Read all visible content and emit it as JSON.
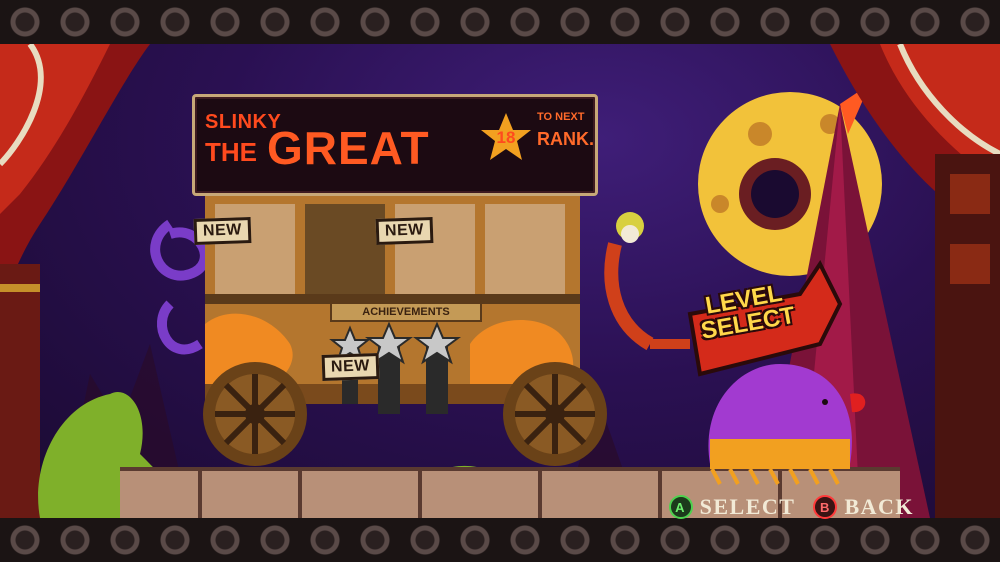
{
  "header": {
    "name_line1": "SLINKY",
    "name_line2": "THE",
    "rank_title": "GREAT",
    "stars_to_next": "18",
    "next_line1": "TO NEXT",
    "next_line2": "RANK."
  },
  "wagon": {
    "new_badges": [
      "NEW",
      "NEW",
      "NEW"
    ],
    "achievements_label": "ACHIEVEMENTS"
  },
  "level_select": {
    "line1": "LEVEL",
    "line2": "SELECT"
  },
  "controls": {
    "select_button": "A",
    "select_label": "SELECT",
    "back_button": "B",
    "back_label": "BACK"
  },
  "colors": {
    "title_orange": "#ff4a1e",
    "sky_purple": "#2a1052",
    "moon_yellow": "#f2c23a",
    "a_button_green": "#4ed14e",
    "b_button_red": "#ff3a3a"
  }
}
